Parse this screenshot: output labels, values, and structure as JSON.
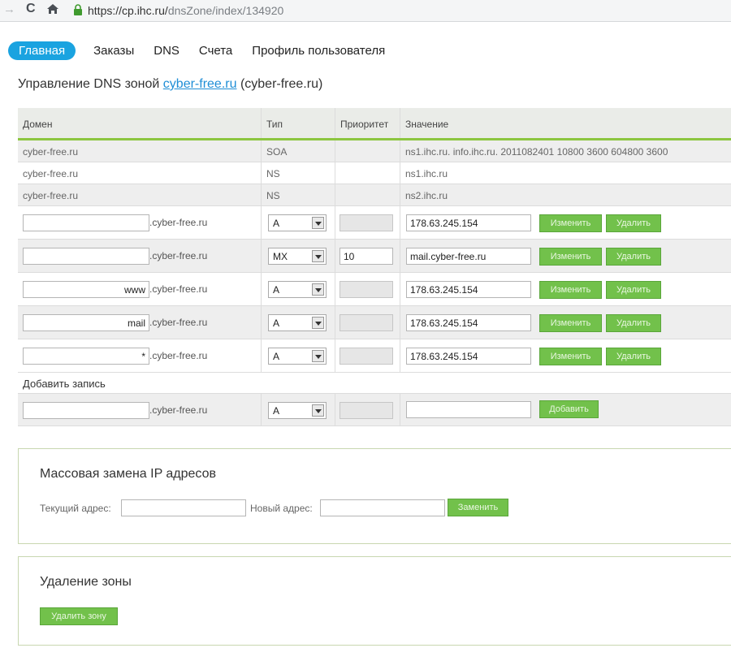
{
  "browser": {
    "url_host": "https://cp.ihc.ru/",
    "url_path": "dnsZone/index/134920"
  },
  "nav": {
    "items": [
      "Главная",
      "Заказы",
      "DNS",
      "Счета",
      "Профиль пользователя"
    ]
  },
  "page": {
    "title_prefix": "Управление DNS зоной",
    "zone_link": "cyber-free.ru",
    "zone_suffix": "(cyber-free.ru)"
  },
  "table": {
    "headers": [
      "Домен",
      "Тип",
      "Приоритет",
      "Значение"
    ],
    "system_rows": [
      {
        "domain": "cyber-free.ru",
        "type": "SOA",
        "priority": "",
        "value": "ns1.ihc.ru. info.ihc.ru. 2011082401 10800 3600 604800 3600"
      },
      {
        "domain": "cyber-free.ru",
        "type": "NS",
        "priority": "",
        "value": "ns1.ihc.ru"
      },
      {
        "domain": "cyber-free.ru",
        "type": "NS",
        "priority": "",
        "value": "ns2.ihc.ru"
      }
    ],
    "domain_suffix": ".cyber-free.ru",
    "edit_label": "Изменить",
    "delete_label": "Удалить",
    "edit_rows": [
      {
        "sub": "",
        "type": "A",
        "priority": "",
        "value": "178.63.245.154"
      },
      {
        "sub": "",
        "type": "MX",
        "priority": "10",
        "value": "mail.cyber-free.ru"
      },
      {
        "sub": "www",
        "type": "A",
        "priority": "",
        "value": "178.63.245.154"
      },
      {
        "sub": "mail",
        "type": "A",
        "priority": "",
        "value": "178.63.245.154"
      },
      {
        "sub": "*",
        "type": "A",
        "priority": "",
        "value": "178.63.245.154"
      }
    ],
    "add_record_label": "Добавить запись",
    "add_row": {
      "sub": "",
      "type": "A",
      "priority": "",
      "value": "",
      "button": "Добавить"
    }
  },
  "mass_replace": {
    "title": "Массовая замена IP адресов",
    "current_label": "Текущий адрес:",
    "new_label": "Новый адрес:",
    "current_value": "",
    "new_value": "",
    "button": "Заменить"
  },
  "delete_zone": {
    "title": "Удаление зоны",
    "button": "Удалить зону"
  },
  "colors": {
    "accent_blue": "#1aa3e0",
    "button_green": "#72c14b",
    "header_border": "#8cc63f",
    "link": "#1f8ed6"
  }
}
